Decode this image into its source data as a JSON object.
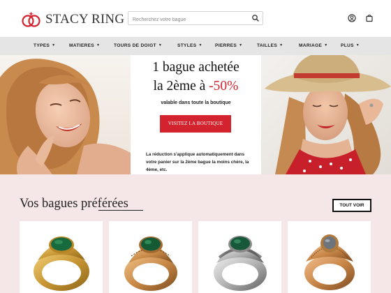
{
  "brand": {
    "name": "STACY RING",
    "accent": "#d3232f"
  },
  "search": {
    "placeholder": "Recherchez votre bague",
    "icon": "search-icon"
  },
  "header_icons": [
    "account-icon",
    "cart-icon"
  ],
  "nav": {
    "items": [
      {
        "label": "TYPES"
      },
      {
        "label": "MATIERES"
      },
      {
        "label": "TOURS DE DOIGT"
      },
      {
        "label": "STYLES"
      },
      {
        "label": "PIERRES"
      },
      {
        "label": "TAILLES"
      },
      {
        "label": "MARIAGE"
      },
      {
        "label": "PLUS"
      }
    ]
  },
  "hero": {
    "line1": "1 bague achetée",
    "line2_prefix": "la 2ème à ",
    "line2_discount": "-50%",
    "subtitle": "valable dans toute la boutique",
    "cta": "VISITEZ LA BOUTIQUE",
    "note": "La réduction s'applique automatiquement dans votre panier sur la 2ème bague la moins chère, la 4ème, etc."
  },
  "favorites": {
    "title": "Vos bagues préférées",
    "all_button": "TOUT VOIR",
    "products": [
      {
        "metal": "gold",
        "stone": "malachite"
      },
      {
        "metal": "rose-gold-filigree",
        "stone": "malachite"
      },
      {
        "metal": "silver",
        "stone": "malachite"
      },
      {
        "metal": "rose-gold-ornate",
        "stone": "grey"
      }
    ]
  }
}
